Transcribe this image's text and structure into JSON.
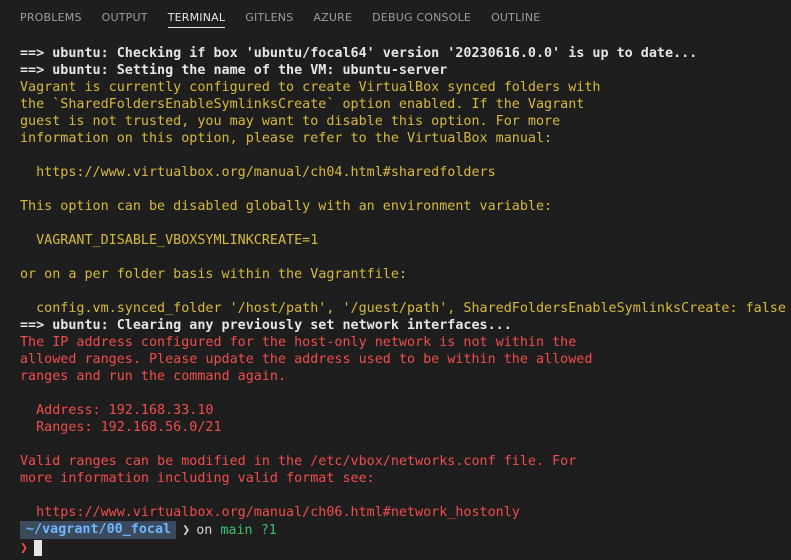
{
  "tabs": [
    {
      "label": "PROBLEMS",
      "active": false
    },
    {
      "label": "OUTPUT",
      "active": false
    },
    {
      "label": "TERMINAL",
      "active": true
    },
    {
      "label": "GITLENS",
      "active": false
    },
    {
      "label": "AZURE",
      "active": false
    },
    {
      "label": "DEBUG CONSOLE",
      "active": false
    },
    {
      "label": "OUTLINE",
      "active": false
    }
  ],
  "terminal": {
    "lines": [
      "==> ubuntu: Checking if box 'ubuntu/focal64' version '20230616.0.0' is up to date...",
      "==> ubuntu: Setting the name of the VM: ubuntu-server",
      "Vagrant is currently configured to create VirtualBox synced folders with",
      "the `SharedFoldersEnableSymlinksCreate` option enabled. If the Vagrant",
      "guest is not trusted, you may want to disable this option. For more",
      "information on this option, please refer to the VirtualBox manual:",
      "",
      "  https://www.virtualbox.org/manual/ch04.html#sharedfolders",
      "",
      "This option can be disabled globally with an environment variable:",
      "",
      "  VAGRANT_DISABLE_VBOXSYMLINKCREATE=1",
      "",
      "or on a per folder basis within the Vagrantfile:",
      "",
      "  config.vm.synced_folder '/host/path', '/guest/path', SharedFoldersEnableSymlinksCreate: false",
      "==> ubuntu: Clearing any previously set network interfaces...",
      "The IP address configured for the host-only network is not within the",
      "allowed ranges. Please update the address used to be within the allowed",
      "ranges and run the command again.",
      "",
      "  Address: 192.168.33.10",
      "  Ranges: 192.168.56.0/21",
      "",
      "Valid ranges can be modified in the /etc/vbox/networks.conf file. For",
      "more information including valid format see:",
      "",
      "  https://www.virtualbox.org/manual/ch06.html#network_hostonly"
    ],
    "line_styles": [
      "white-bold",
      "white-bold",
      "yellow2",
      "yellow2",
      "yellow2",
      "yellow2",
      "yellow2",
      "yellow2",
      "yellow2",
      "yellow2",
      "yellow2",
      "yellow2",
      "yellow2",
      "yellow2",
      "yellow2",
      "yellow2",
      "white-bold",
      "red",
      "red",
      "red",
      "red",
      "red",
      "red",
      "red",
      "red",
      "red",
      "red",
      "red"
    ]
  },
  "prompt": {
    "path": "~/vagrant/00_focal",
    "separator": "❯",
    "on_word": "on",
    "branch": "main",
    "status": "?1",
    "input_arrow": "❯"
  },
  "colors": {
    "background": "#1e1e1e",
    "bold_white": "#e6e6e6",
    "warning_yellow": "#d7ba3a",
    "error_red": "#f14c4c",
    "path_bg": "#3b4a5c",
    "path_fg": "#6fb6ff",
    "git_green": "#39c26d"
  }
}
